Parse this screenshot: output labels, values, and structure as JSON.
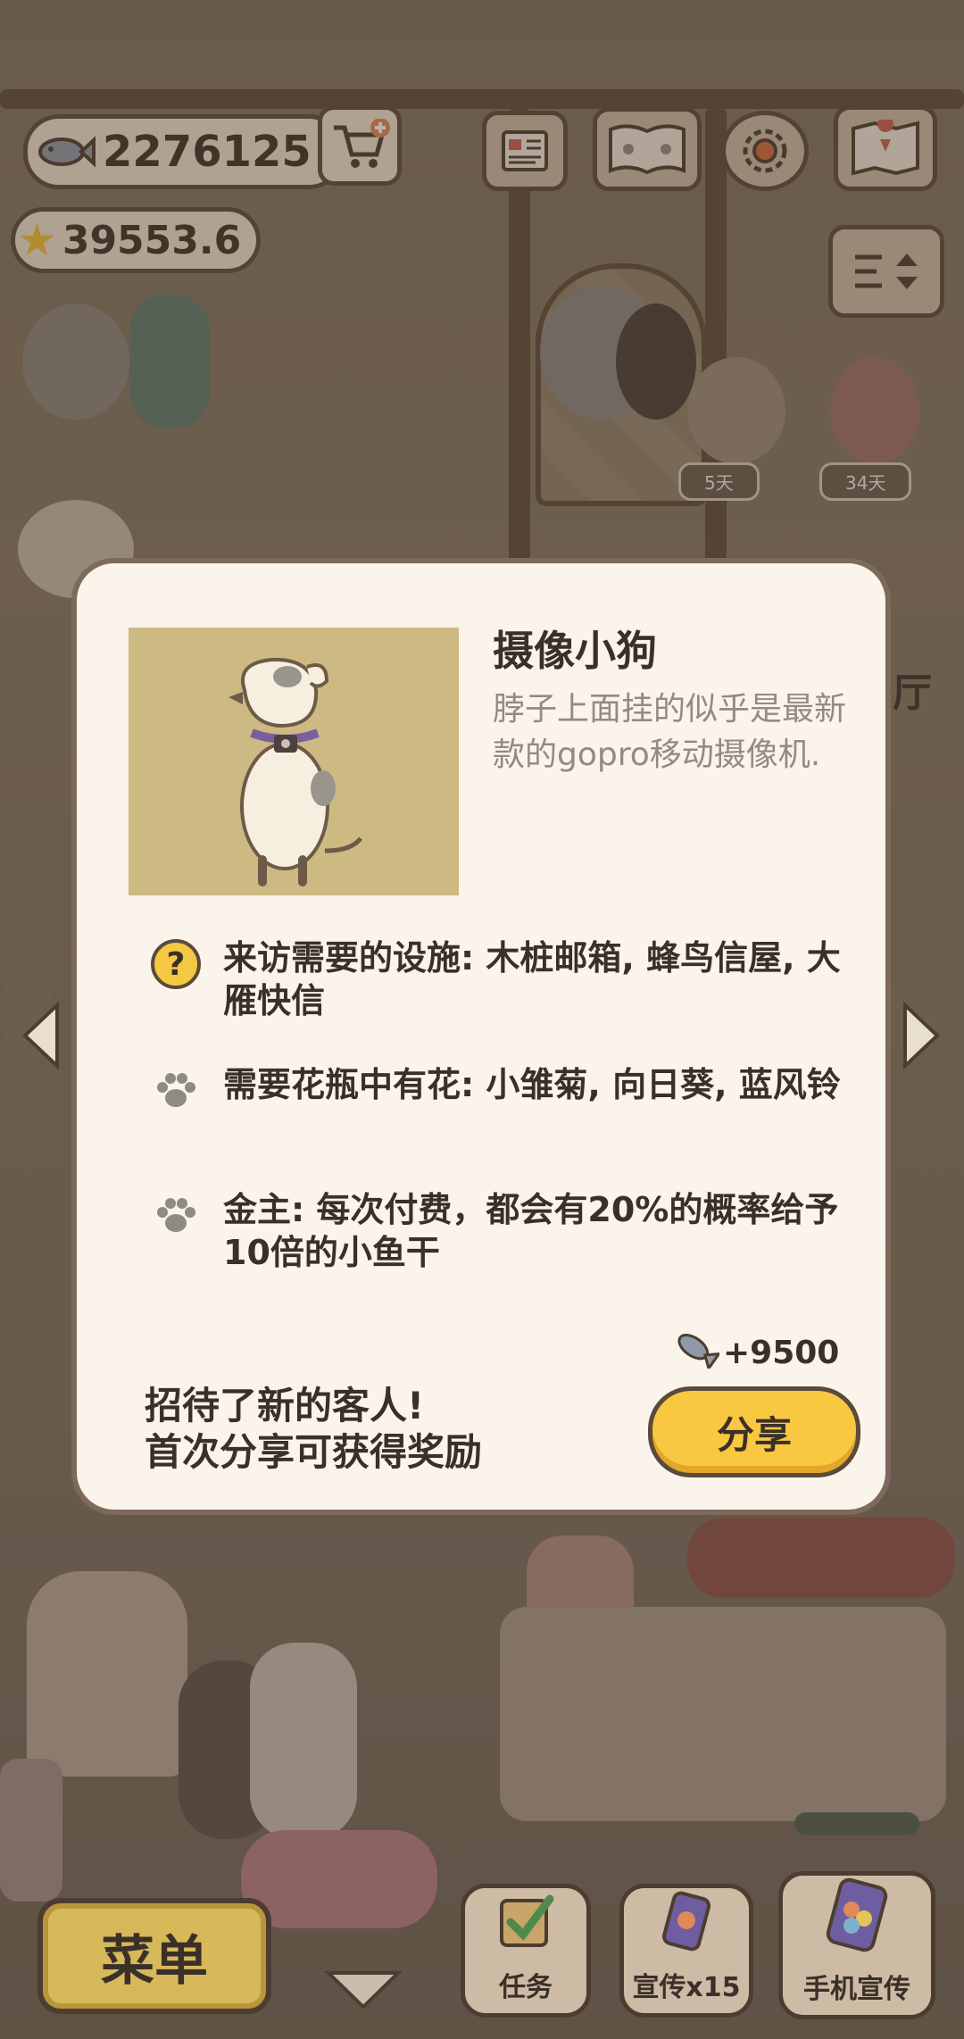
{
  "currency": {
    "fish": "2276125",
    "stars": "39553.6"
  },
  "top_icons": [
    "shop-cart-plus-icon",
    "newspaper-icon",
    "paw-book-icon",
    "settings-gear-icon",
    "map-icon",
    "sort-arrows-icon"
  ],
  "scene_tags": {
    "tag1": "5天",
    "tag2": "34天",
    "sign": "厅"
  },
  "card": {
    "title": "摄像小狗",
    "description": "脖子上面挂的似乎是最新款的gopro移动摄像机.",
    "requirements": [
      {
        "icon": "question-icon",
        "text": "来访需要的设施: 木桩邮箱, 蜂鸟信屋, 大雁快信"
      },
      {
        "icon": "paw-icon",
        "text": "需要花瓶中有花: 小雏菊, 向日葵, 蓝风铃"
      },
      {
        "icon": "paw-icon",
        "text": "金主: 每次付费，都会有20%的概率给予10倍的小鱼干"
      }
    ],
    "reward": "+9500",
    "promo_line1": "招待了新的客人!",
    "promo_line2": "首次分享可获得奖励",
    "share_label": "分享"
  },
  "bottom": {
    "menu": "菜单",
    "tasks": "任务",
    "promo_x15": "宣传x15",
    "phone_promo": "手机宣传"
  },
  "colors": {
    "card_bg": "#fbf4ea",
    "share_button": "#f8c840",
    "portrait_bg": "#cdb982",
    "dark_outline": "#5b4a3c"
  }
}
